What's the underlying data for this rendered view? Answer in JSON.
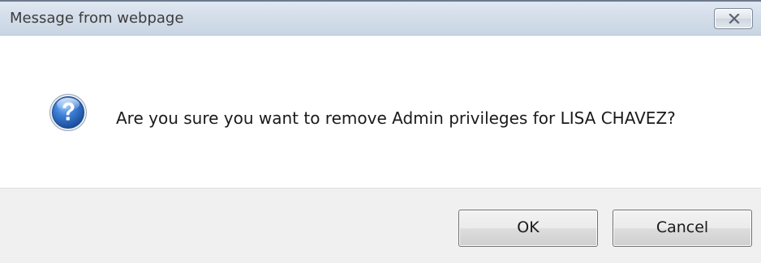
{
  "dialog": {
    "title": "Message from webpage",
    "close_icon": "close-x-icon",
    "message": "Are you sure you want to remove Admin privileges for LISA CHAVEZ?",
    "message_icon": "question-icon",
    "buttons": {
      "ok_label": "OK",
      "cancel_label": "Cancel"
    }
  },
  "colors": {
    "titlebar_top": "#dfe7f2",
    "titlebar_bottom": "#c9d5e4",
    "footer_background": "#f0f0f0",
    "icon_blue": "#2f6fc0"
  }
}
